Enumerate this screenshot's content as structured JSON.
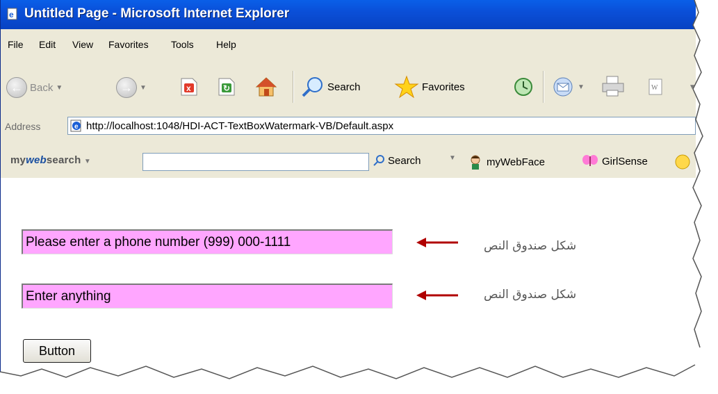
{
  "window": {
    "title": "Untitled Page - Microsoft Internet Explorer"
  },
  "menu": {
    "items": [
      "File",
      "Edit",
      "View",
      "Favorites",
      "Tools",
      "Help"
    ]
  },
  "toolbar": {
    "back_label": "Back",
    "search_label": "Search",
    "favorites_label": "Favorites"
  },
  "address": {
    "label": "Address",
    "url": "http://localhost:1048/HDI-ACT-TextBoxWatermark-VB/Default.aspx"
  },
  "searchbar": {
    "logo_prefix": "my",
    "logo_web": "web",
    "logo_suffix": "search",
    "search_label": "Search",
    "mywebface_label": "myWebFace",
    "girlsense_label": "GirlSense"
  },
  "form": {
    "textbox1_value": "Please enter a phone number (999) 000-1111",
    "textbox2_value": "Enter anything",
    "annotation1": "شكل صندوق النص",
    "annotation2": "شكل صندوق النص",
    "button_label": "Button",
    "textbox_bg_color": "#ffa6ff",
    "arrow_color": "#b00000"
  }
}
